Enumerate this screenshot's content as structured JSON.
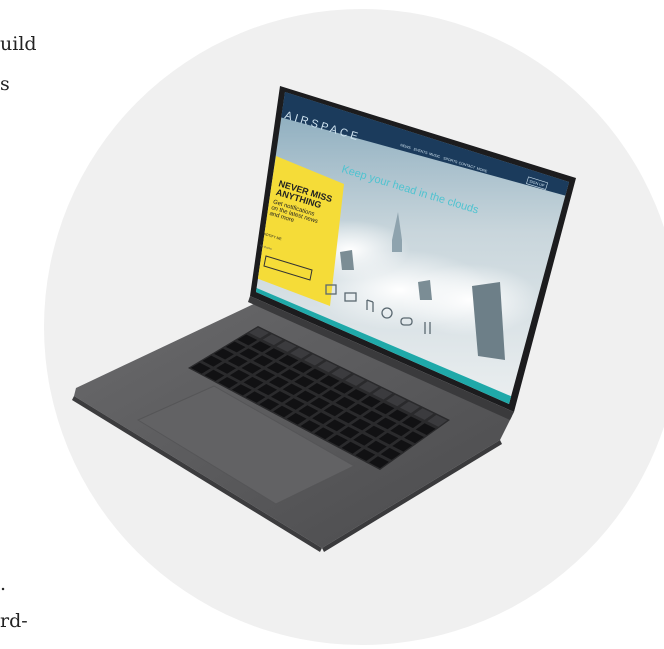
{
  "left_text": {
    "line1": "uild",
    "line2": "s",
    "line3": ".",
    "line4": "rd-"
  },
  "laptop_screen": {
    "brand": "AIRSPACE",
    "nav_items": [
      "NEWS",
      "EVENTS",
      "MUSIC",
      "SPORTS",
      "CONTACT",
      "MORE"
    ],
    "signup": "SIGN UP",
    "tagline": "Keep your head in the clouds",
    "promo": {
      "heading_line1": "NEVER MISS",
      "heading_line2": "ANYTHING",
      "body_line1": "Get notifications",
      "body_line2": "on the latest news",
      "body_line3": "and more",
      "button": "NOTIFY ME",
      "small_link": "No thanks"
    },
    "icons": [
      "grid-icon",
      "mail-icon",
      "music-icon",
      "compass-icon",
      "gamepad-icon",
      "utensils-icon"
    ]
  },
  "colors": {
    "circle_bg": "#f0f0f0",
    "laptop_body": "#5b5b5d",
    "screen_navy": "#1b3b5c",
    "promo_yellow": "#f5dc38",
    "teal_bar": "#1fa9a9",
    "sky": "#c9d6dc"
  }
}
